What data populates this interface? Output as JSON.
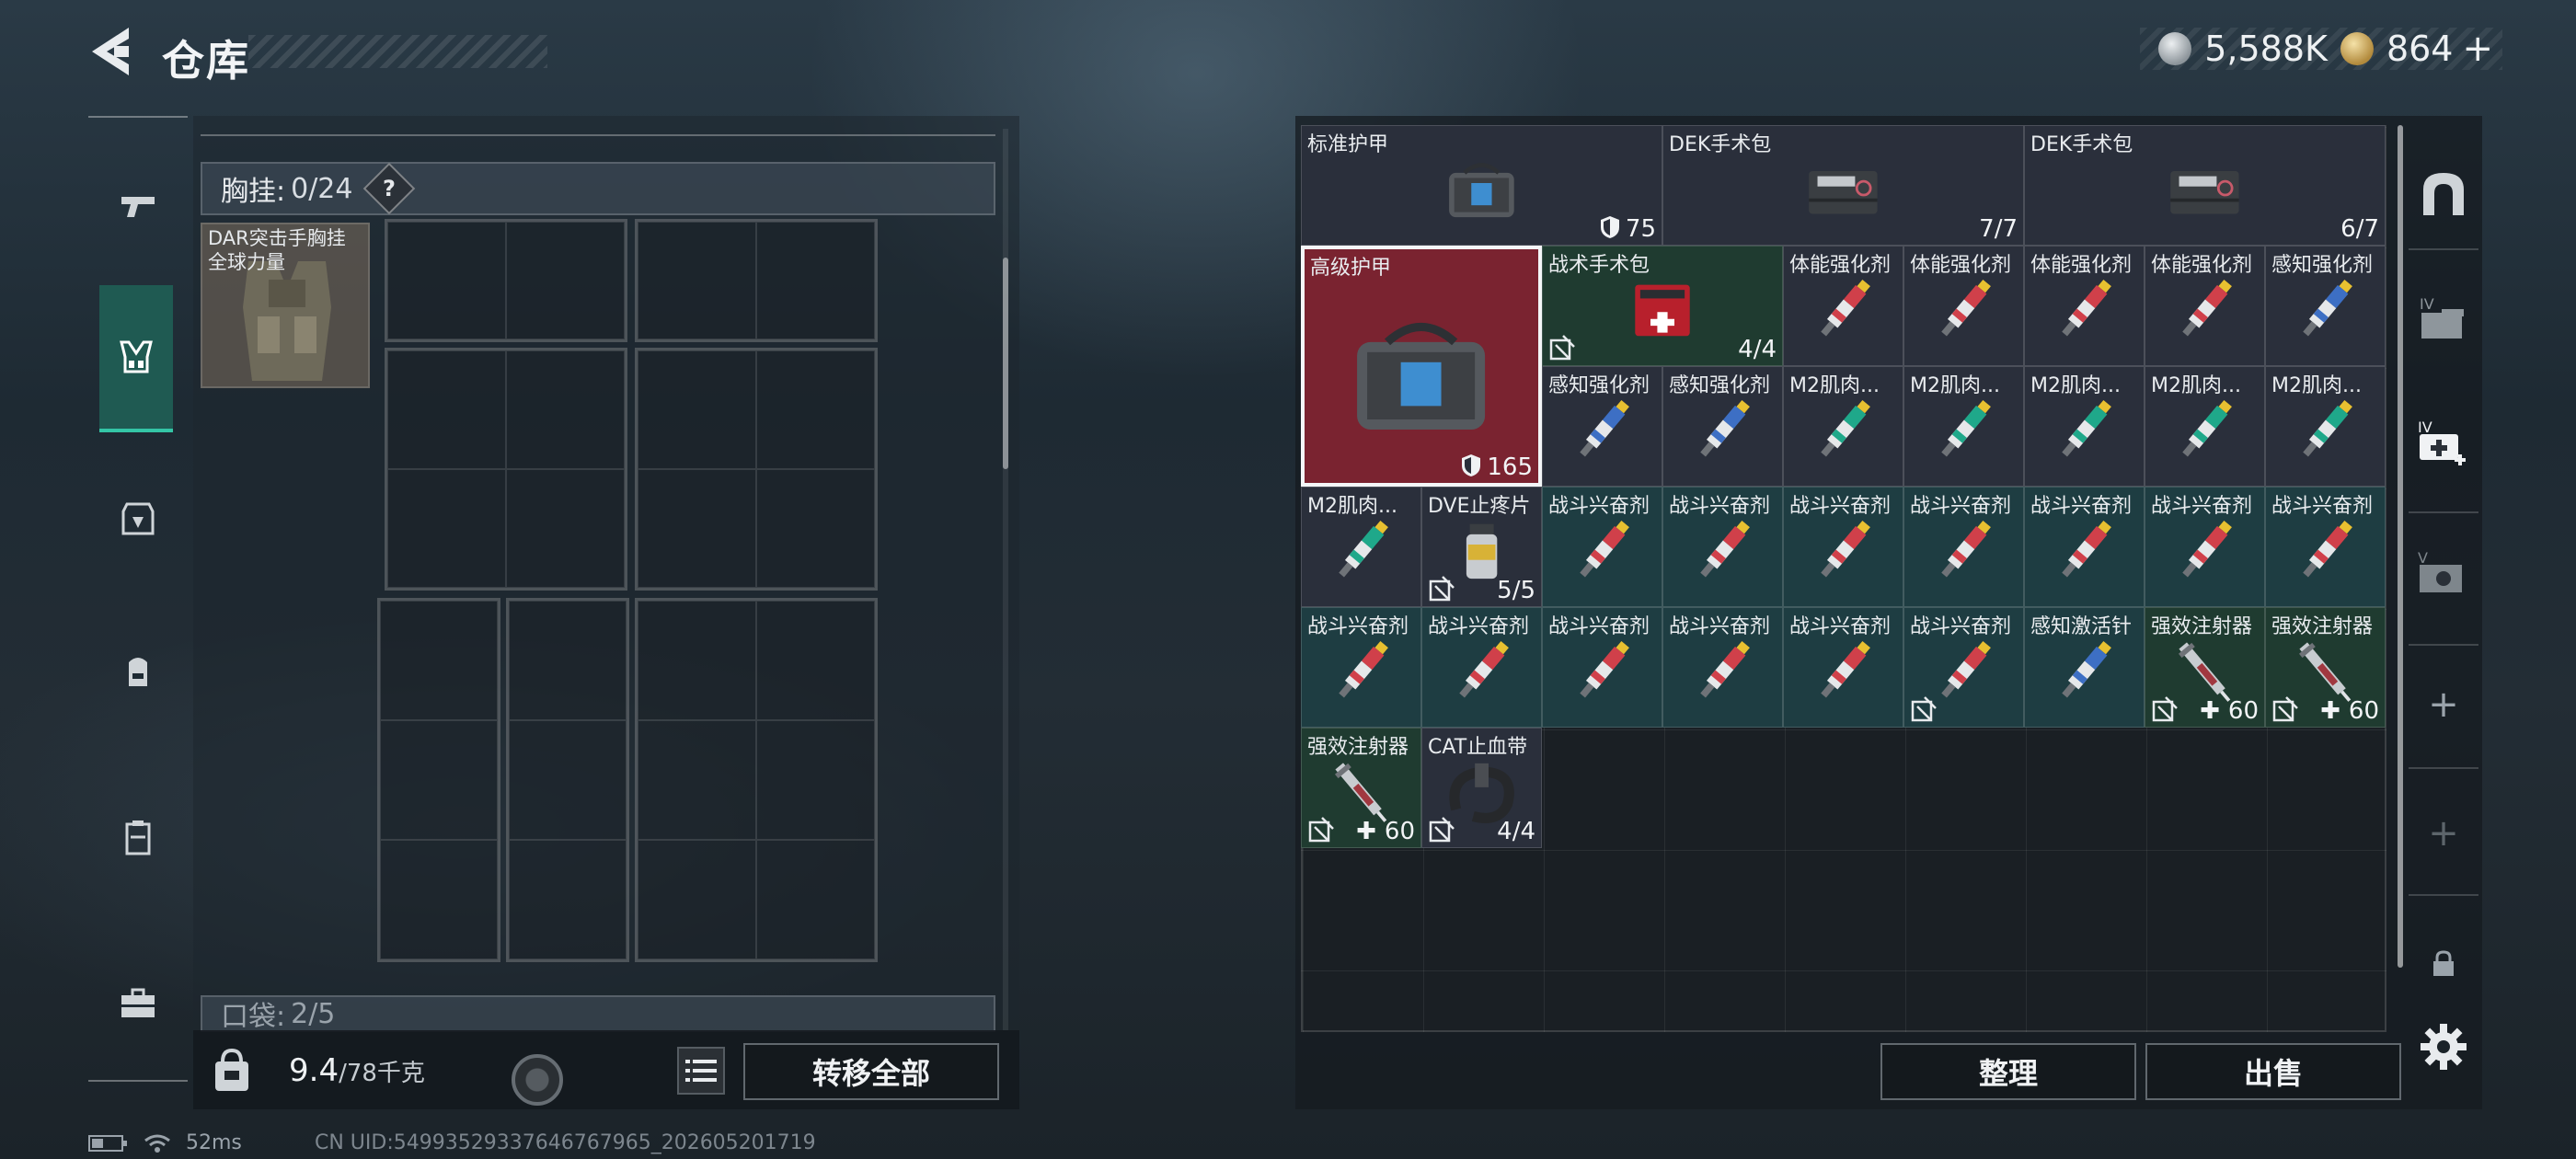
{
  "header": {
    "title": "仓库"
  },
  "currency": {
    "silver": "5,588K",
    "gold": "864",
    "plus": "+"
  },
  "left": {
    "section_label": "胸挂:",
    "section_count": "0/24",
    "help": "?",
    "rig_name": "DAR突击手胸挂",
    "rig_sub": "全球力量",
    "pocket_label": "口袋:",
    "pocket_count": "2/5",
    "weight_value": "9.4",
    "weight_capacity": "/78千克",
    "transfer_all": "转移全部"
  },
  "inventory": [
    {
      "name": "标准护甲",
      "count": "75",
      "tone": "dark",
      "icon": "armor-bag",
      "shield": true
    },
    {
      "name": "DEK手术包",
      "count": "7/7",
      "tone": "dark",
      "icon": "surgery-kit"
    },
    {
      "name": "DEK手术包",
      "count": "6/7",
      "tone": "dark",
      "icon": "surgery-kit"
    },
    {
      "name": "高级护甲",
      "count": "165",
      "tone": "red",
      "icon": "armor-bag",
      "shield": true,
      "selected": true
    },
    {
      "name": "战术手术包",
      "count": "4/4",
      "tone": "green",
      "icon": "first-aid-kit",
      "locked": true
    },
    {
      "name": "体能强化剂",
      "tone": "dark",
      "icon": "injector-red"
    },
    {
      "name": "体能强化剂",
      "tone": "dark",
      "icon": "injector-red"
    },
    {
      "name": "体能强化剂",
      "tone": "dark",
      "icon": "injector-red"
    },
    {
      "name": "体能强化剂",
      "tone": "dark",
      "icon": "injector-red"
    },
    {
      "name": "感知强化剂",
      "tone": "dark",
      "icon": "injector-blue"
    },
    {
      "name": "感知强化剂",
      "tone": "dark",
      "icon": "injector-blue"
    },
    {
      "name": "感知强化剂",
      "tone": "dark",
      "icon": "injector-blue"
    },
    {
      "name": "M2肌肉...",
      "tone": "dark",
      "icon": "injector-green"
    },
    {
      "name": "M2肌肉...",
      "tone": "dark",
      "icon": "injector-green"
    },
    {
      "name": "M2肌肉...",
      "tone": "dark",
      "icon": "injector-green"
    },
    {
      "name": "M2肌肉...",
      "tone": "dark",
      "icon": "injector-green"
    },
    {
      "name": "M2肌肉...",
      "tone": "dark",
      "icon": "injector-green"
    },
    {
      "name": "M2肌肉...",
      "tone": "dark",
      "icon": "injector-green"
    },
    {
      "name": "DVE止疼片",
      "count": "5/5",
      "tone": "dark",
      "icon": "pill-bottle",
      "locked": true
    },
    {
      "name": "战斗兴奋剂",
      "tone": "teal",
      "icon": "injector-red"
    },
    {
      "name": "战斗兴奋剂",
      "tone": "teal",
      "icon": "injector-red"
    },
    {
      "name": "战斗兴奋剂",
      "tone": "teal",
      "icon": "injector-red"
    },
    {
      "name": "战斗兴奋剂",
      "tone": "teal",
      "icon": "injector-red"
    },
    {
      "name": "战斗兴奋剂",
      "tone": "teal",
      "icon": "injector-red"
    },
    {
      "name": "战斗兴奋剂",
      "tone": "teal",
      "icon": "injector-red"
    },
    {
      "name": "战斗兴奋剂",
      "tone": "teal",
      "icon": "injector-red"
    },
    {
      "name": "战斗兴奋剂",
      "tone": "teal",
      "icon": "injector-red"
    },
    {
      "name": "战斗兴奋剂",
      "tone": "teal",
      "icon": "injector-red"
    },
    {
      "name": "战斗兴奋剂",
      "tone": "teal",
      "icon": "injector-red"
    },
    {
      "name": "战斗兴奋剂",
      "tone": "teal",
      "icon": "injector-red"
    },
    {
      "name": "战斗兴奋剂",
      "tone": "teal",
      "icon": "injector-red"
    },
    {
      "name": "战斗兴奋剂",
      "tone": "teal",
      "icon": "injector-red",
      "locked": true
    },
    {
      "name": "感知激活针",
      "tone": "teal",
      "icon": "injector-blue"
    },
    {
      "name": "强效注射器",
      "count": "60",
      "tone": "green",
      "icon": "syringe",
      "locked": true,
      "heal": true
    },
    {
      "name": "强效注射器",
      "count": "60",
      "tone": "green",
      "icon": "syringe",
      "locked": true,
      "heal": true
    },
    {
      "name": "强效注射器",
      "count": "60",
      "tone": "green",
      "icon": "syringe",
      "locked": true,
      "heal": true
    },
    {
      "name": "CAT止血带",
      "count": "4/4",
      "tone": "dark",
      "icon": "tourniquet",
      "locked": true
    }
  ],
  "buttons": {
    "sort": "整理",
    "sell": "出售"
  },
  "right_side": {
    "add1": "+",
    "add2": "+"
  },
  "status": {
    "ping": "52ms",
    "uid": "CN UID:5499352933764676796​5_202605201719"
  }
}
